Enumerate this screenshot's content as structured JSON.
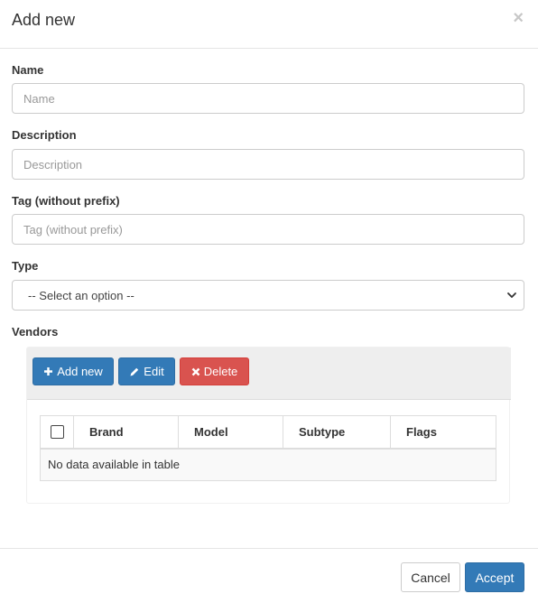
{
  "modal": {
    "title": "Add new",
    "close_symbol": "×"
  },
  "form": {
    "name": {
      "label": "Name",
      "placeholder": "Name",
      "value": ""
    },
    "description": {
      "label": "Description",
      "placeholder": "Description",
      "value": ""
    },
    "tag": {
      "label": "Tag (without prefix)",
      "placeholder": "Tag (without prefix)",
      "value": ""
    },
    "type": {
      "label": "Type",
      "selected": "-- Select an option --"
    }
  },
  "vendors": {
    "label": "Vendors",
    "toolbar": {
      "add_label": "Add new",
      "add_icon": "plus-icon",
      "edit_label": "Edit",
      "edit_icon": "pencil-icon",
      "delete_label": "Delete",
      "delete_icon": "x-icon"
    },
    "table": {
      "columns": [
        "Brand",
        "Model",
        "Subtype",
        "Flags"
      ],
      "empty_message": "No data available in table"
    }
  },
  "footer": {
    "cancel_label": "Cancel",
    "accept_label": "Accept"
  },
  "colors": {
    "primary": "#337ab7",
    "danger": "#d9534f",
    "border": "#cccccc"
  }
}
